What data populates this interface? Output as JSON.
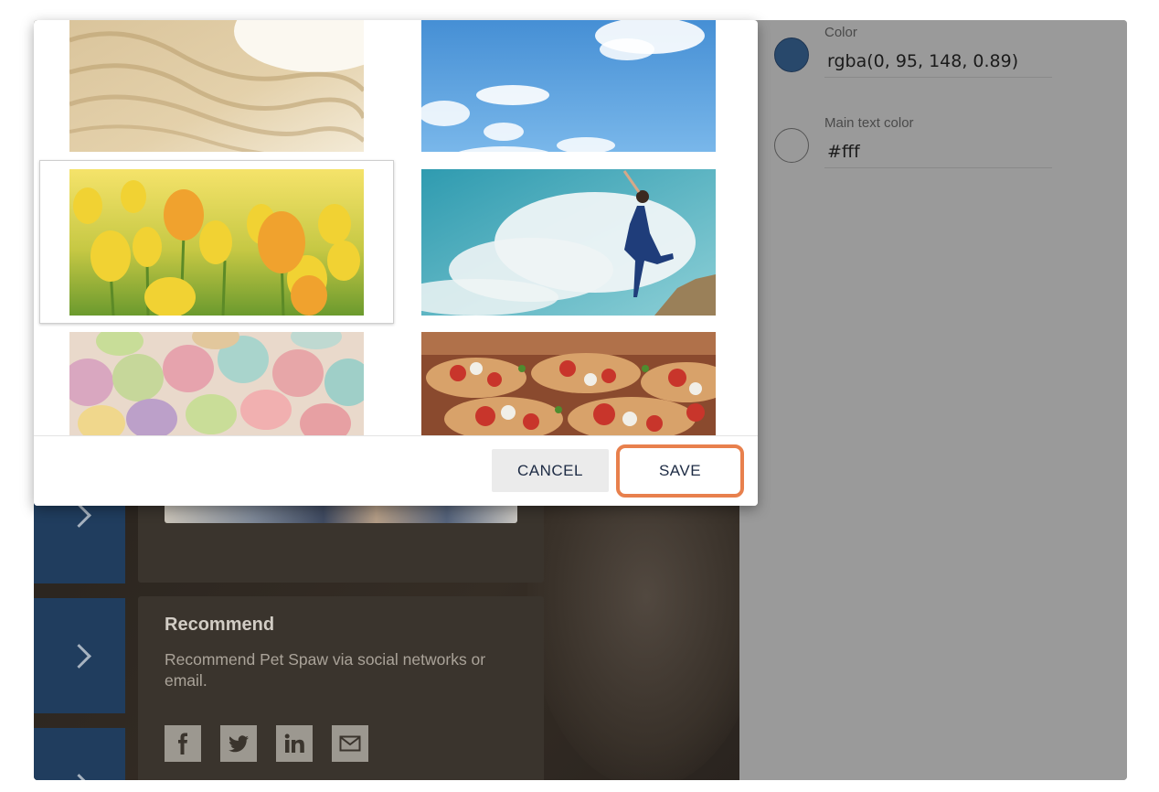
{
  "properties": {
    "color": {
      "label": "Color",
      "value": "rgba(0, 95, 148, 0.89)",
      "swatch": "#28486b"
    },
    "main_text_color": {
      "label": "Main text color",
      "value": "#fff",
      "swatch": "#9a9a9a"
    }
  },
  "preview": {
    "recommend": {
      "title": "Recommend",
      "text": "Recommend Pet Spaw via social networks or email."
    },
    "social_icons": [
      "facebook-icon",
      "twitter-icon",
      "linkedin-icon",
      "email-icon"
    ]
  },
  "gallery": {
    "images": [
      "sand",
      "sky",
      "tulips",
      "dancer-in-clouds",
      "macarons",
      "bruschetta"
    ],
    "selected": "tulips"
  },
  "dialog": {
    "cancel_label": "CANCEL",
    "save_label": "SAVE"
  },
  "colors": {
    "accent_highlight": "#e8804d",
    "nav_blue": "#203d5e"
  }
}
